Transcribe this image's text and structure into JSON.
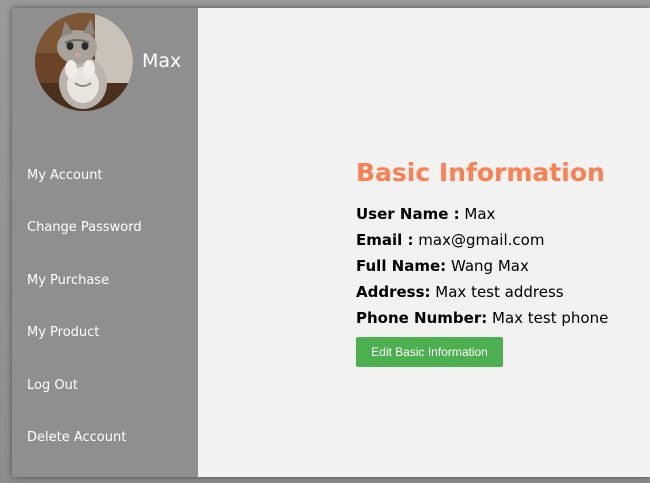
{
  "sidebar": {
    "username": "Max",
    "avatar_icon": "cat-photo",
    "items": [
      {
        "label": "My Account"
      },
      {
        "label": "Change Password"
      },
      {
        "label": "My Purchase"
      },
      {
        "label": "My Product"
      },
      {
        "label": "Log Out"
      },
      {
        "label": "Delete Account"
      }
    ]
  },
  "main": {
    "title": "Basic Information",
    "fields": [
      {
        "label": "User Name :",
        "value": "Max"
      },
      {
        "label": "Email :",
        "value": "max@gmail.com"
      },
      {
        "label": "Full Name:",
        "value": "Wang Max"
      },
      {
        "label": "Address:",
        "value": "Max test address"
      },
      {
        "label": "Phone Number:",
        "value": "Max test phone"
      }
    ],
    "edit_button_label": "Edit Basic Information"
  },
  "colors": {
    "sidebar_bg": "#8f8f8f",
    "title": "#ff7f50",
    "button_bg": "#4caf50"
  }
}
